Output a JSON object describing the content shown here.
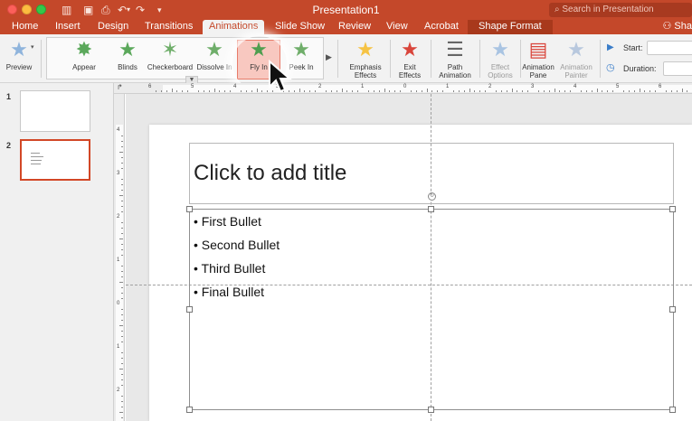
{
  "window": {
    "title": "Presentation1",
    "search_placeholder": "Search in Presentation",
    "share_label": "Sha"
  },
  "tabs": [
    {
      "label": "Home"
    },
    {
      "label": "Insert"
    },
    {
      "label": "Design"
    },
    {
      "label": "Transitions"
    },
    {
      "label": "Animations",
      "active": true
    },
    {
      "label": "Slide Show"
    },
    {
      "label": "Review"
    },
    {
      "label": "View"
    },
    {
      "label": "Acrobat"
    },
    {
      "label": "Shape Format"
    }
  ],
  "ribbon": {
    "preview_label": "Preview",
    "gallery": [
      {
        "label": "Appear"
      },
      {
        "label": "Blinds"
      },
      {
        "label": "Checkerboard"
      },
      {
        "label": "Dissolve In"
      },
      {
        "label": "Fly In",
        "selected": true
      },
      {
        "label": "Peek In"
      }
    ],
    "emphasis_label": "Emphasis Effects",
    "emphasis_l1": "Emphasis",
    "emphasis_l2": "Effects",
    "exit_l1": "Exit",
    "exit_l2": "Effects",
    "path_l1": "Path",
    "path_l2": "Animation",
    "options_l1": "Effect",
    "options_l2": "Options",
    "pane_l1": "Animation",
    "pane_l2": "Pane",
    "painter_l1": "Animation",
    "painter_l2": "Painter",
    "start_label": "Start:",
    "duration_label": "Duration:"
  },
  "thumbnails": [
    {
      "number": "1"
    },
    {
      "number": "2",
      "active": true
    }
  ],
  "ruler": {
    "h_numbers": [
      "6",
      "5",
      "4",
      "3",
      "2",
      "1",
      "0",
      "1",
      "2",
      "3",
      "4",
      "5",
      "6"
    ],
    "v_numbers": [
      "4",
      "3",
      "2",
      "1",
      "0",
      "1",
      "2",
      "3",
      "4"
    ]
  },
  "slide": {
    "title_placeholder": "Click to add title",
    "bullets": [
      "First Bullet",
      "Second Bullet",
      "Third Bullet",
      "Final Bullet"
    ]
  },
  "colors": {
    "accent": "#c4482a",
    "star_green": "#5ba85b",
    "star_yellow": "#f6c343",
    "star_red": "#d9453b",
    "selection": "#f8c8c0"
  }
}
